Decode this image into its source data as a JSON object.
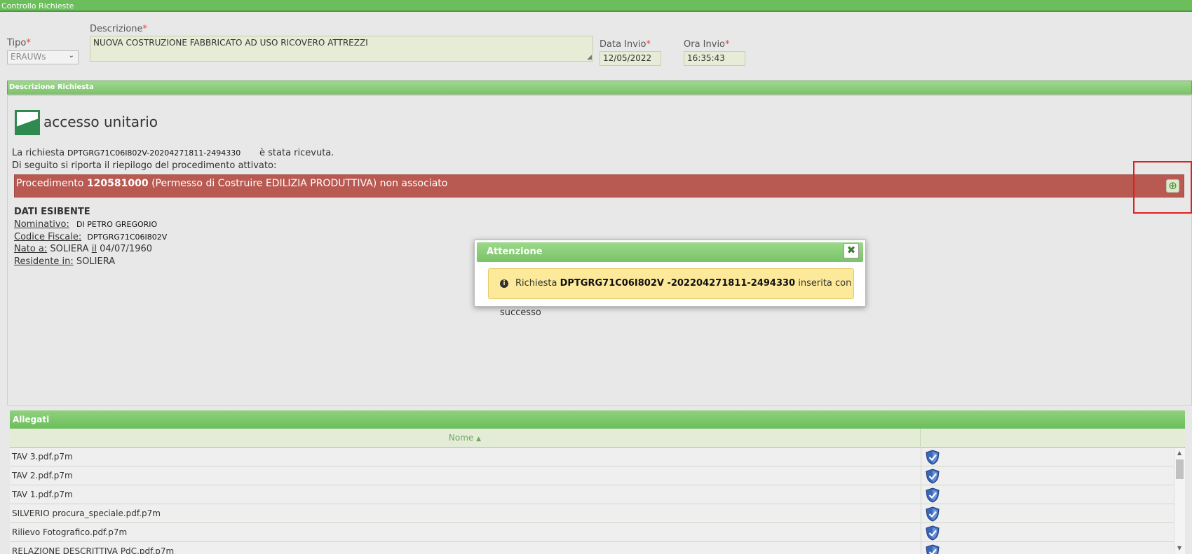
{
  "window": {
    "title": "Controllo Richieste"
  },
  "form": {
    "tipo_label": "Tipo",
    "tipo_value": "ERAUWs",
    "descrizione_label": "Descrizione",
    "descrizione_value": "NUOVA COSTRUZIONE FABBRICATO AD USO RICOVERO ATTREZZI",
    "data_invio_label": "Data Invio",
    "data_invio_value": "12/05/2022",
    "ora_invio_label": "Ora Invio",
    "ora_invio_value": "16:35:43",
    "required_mark": "*"
  },
  "section": {
    "title": "Descrizione Richiesta",
    "logo_text": "accesso unitario",
    "richiesta_prefix": "La richiesta",
    "richiesta_code": "DPTGRG71C06I802V-20204271811-2494330",
    "richiesta_suffix": "è stata ricevuta.",
    "riepilogo": "Di seguito si riporta il riepilogo del procedimento attivato:",
    "procedimento_prefix": "Procedimento",
    "procedimento_code": "120581000",
    "procedimento_suffix": "(Permesso di Costruire EDILIZIA PRODUTTIVA) non associato",
    "plus_icon": "⊕"
  },
  "esibente": {
    "heading": "DATI ESIBENTE",
    "nominativo_label": "Nominativo:",
    "nominativo_value": "DI PETRO GREGORIO",
    "cf_label": "Codice Fiscale:",
    "cf_value": "DPTGRG71C06I802V",
    "nato_label": "Nato a:",
    "nato_value": "SOLIERA",
    "il_label": "il",
    "il_value": "04/07/1960",
    "residente_label": "Residente in:",
    "residente_value": "SOLIERA"
  },
  "allegati": {
    "title": "Allegati",
    "col_nome": "Nome",
    "sort_icon": "▲",
    "rows": [
      {
        "name": "TAV 3.pdf.p7m"
      },
      {
        "name": "TAV 2.pdf.p7m"
      },
      {
        "name": "TAV 1.pdf.p7m"
      },
      {
        "name": "SILVERIO procura_speciale.pdf.p7m"
      },
      {
        "name": "Rilievo Fotografico.pdf.p7m"
      },
      {
        "name": "RELAZIONE DESCRITTIVA PdC.pdf.p7m"
      }
    ]
  },
  "dialog": {
    "title": "Attenzione",
    "close_icon": "✖",
    "info_icon": "i",
    "msg_prefix": "Richiesta",
    "msg_code": "DPTGRG71C06I802V -202204271811-2494330",
    "msg_suffix": "inserita con successo"
  },
  "colors": {
    "accent_green": "#6cbd5b",
    "error_red": "#b85a52",
    "notice_yellow": "#fde99a"
  }
}
